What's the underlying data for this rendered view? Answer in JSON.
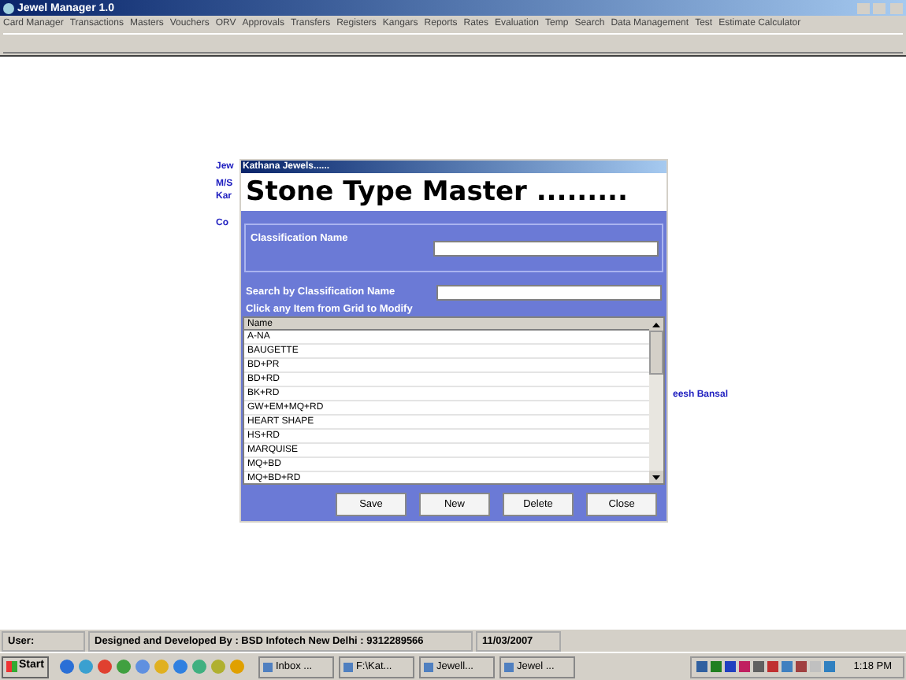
{
  "window": {
    "title": "Jewel Manager 1.0"
  },
  "menu": [
    "Card Manager",
    "Transactions",
    "Masters",
    "Vouchers",
    "ORV",
    "Approvals",
    "Transfers",
    "Registers",
    "Kangars",
    "Reports",
    "Rates",
    "Evaluation",
    "Temp",
    "Search",
    "Data Management",
    "Test",
    "Estimate Calculator"
  ],
  "background_texts": [
    "Jew",
    "M/S",
    "Kar",
    "Co",
    "eesh Bansal"
  ],
  "dialog": {
    "title": "Kathana Jewels......",
    "heading": "Stone Type Master .........",
    "fields": [
      {
        "label": "Classification Name"
      },
      {
        "label": "Search by Classification Name"
      }
    ],
    "hint": "Click any Item from Grid to Modify",
    "grid": {
      "column": "Name",
      "rows": [
        "A-NA",
        "BAUGETTE",
        "BD+PR",
        "BD+RD",
        "BK+RD",
        "GW+EM+MQ+RD",
        "HEART SHAPE",
        "HS+RD",
        "MARQUISE",
        "MQ+BD",
        "MQ+BD+RD"
      ]
    },
    "buttons": [
      "Save",
      "New",
      "Delete",
      "Close"
    ]
  },
  "status_bar": [
    "User:",
    "Designed and Developed By : BSD Infotech New Delhi : 9312289566",
    "11/03/2007"
  ],
  "taskbar": {
    "start": "Start",
    "tasks": [
      "Inbox ...",
      "F:\\Kat...",
      "Jewell...",
      "Jewel ..."
    ],
    "clock": "1:18 PM"
  }
}
